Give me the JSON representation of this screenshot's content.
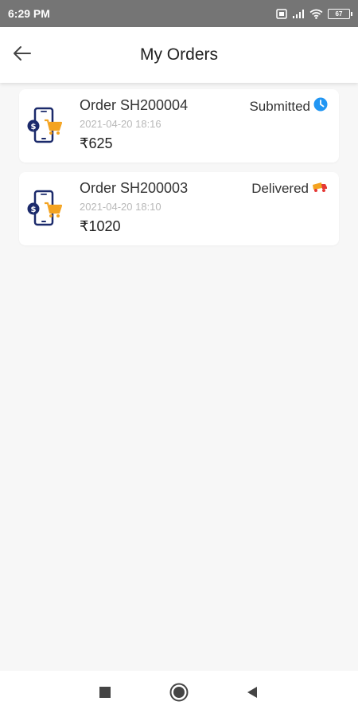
{
  "status_bar": {
    "time": "6:29 PM",
    "battery": "67",
    "icons": [
      "sim-icon",
      "signal-icon",
      "wifi-icon",
      "battery-icon"
    ]
  },
  "app_bar": {
    "title": "My Orders",
    "back_icon": "back-arrow-icon"
  },
  "orders": [
    {
      "id": "Order SH200004",
      "date": "2021-04-20 18:16",
      "amount": "₹625",
      "status": "Submitted",
      "status_icon": "clock-icon"
    },
    {
      "id": "Order SH200003",
      "date": "2021-04-20 18:10",
      "amount": "₹1020",
      "status": "Delivered",
      "status_icon": "delivery-truck-icon"
    }
  ],
  "nav_bar": {
    "buttons": [
      "recents-square-icon",
      "home-circle-icon",
      "back-triangle-icon"
    ]
  },
  "colors": {
    "status_bar_bg": "#757575",
    "background": "#f7f7f7",
    "accent_blue": "#2196f3",
    "cart_orange": "#f4a320",
    "icon_navy": "#1b2a6b"
  }
}
